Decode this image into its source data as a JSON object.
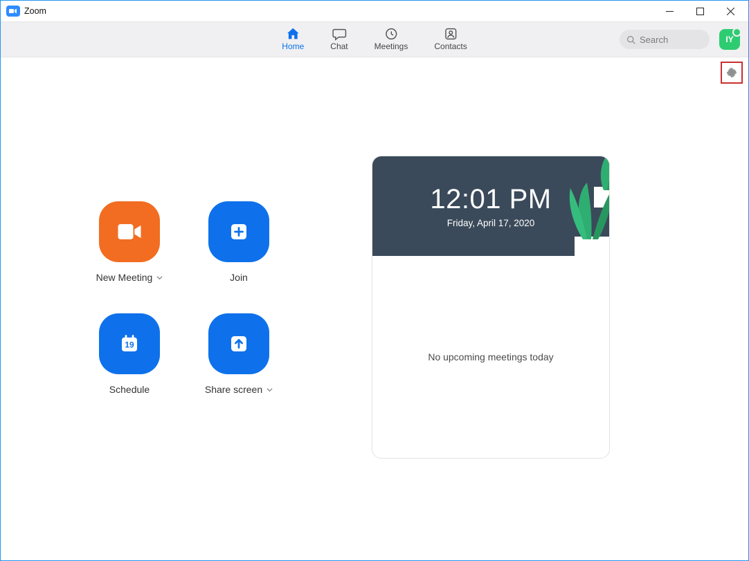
{
  "window": {
    "title": "Zoom"
  },
  "nav": {
    "tabs": [
      {
        "label": "Home"
      },
      {
        "label": "Chat"
      },
      {
        "label": "Meetings"
      },
      {
        "label": "Contacts"
      }
    ],
    "search_placeholder": "Search",
    "avatar_initials": "IY"
  },
  "tiles": {
    "new_meeting": "New Meeting",
    "join": "Join",
    "schedule": "Schedule",
    "schedule_day": "19",
    "share_screen": "Share screen"
  },
  "clock": {
    "time": "12:01 PM",
    "date": "Friday, April 17, 2020"
  },
  "meetings": {
    "empty_message": "No upcoming meetings today"
  }
}
